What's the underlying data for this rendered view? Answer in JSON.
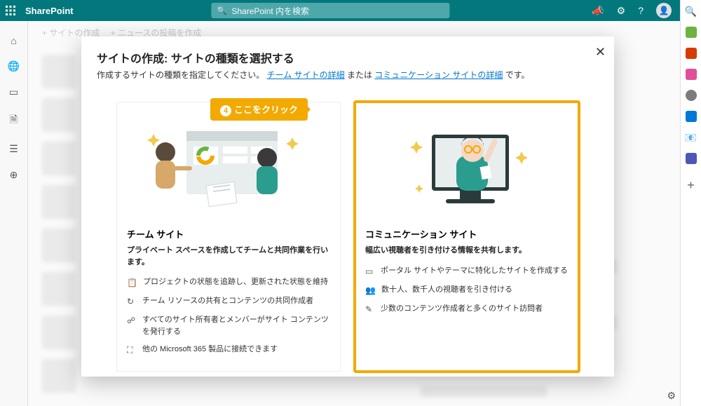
{
  "header": {
    "title": "SharePoint",
    "search_placeholder": "SharePoint 内を検索"
  },
  "toolbar": {
    "create_site": "+ サイトの作成",
    "create_news": "+ ニュースの投稿を作成"
  },
  "modal": {
    "title": "サイトの作成: サイトの種類を選択する",
    "subtitle_prefix": "作成するサイトの種類を指定してください。",
    "link_team": "チーム サイトの詳細",
    "subtitle_or": " または ",
    "link_comm": "コミュニケーション サイトの詳細",
    "subtitle_suffix": " です。"
  },
  "callout": {
    "num": "4",
    "text": "ここをクリック"
  },
  "cards": {
    "team": {
      "title": "チーム サイト",
      "desc": "プライベート スペースを作成してチームと共同作業を行います。",
      "items": [
        "プロジェクトの状態を追跡し、更新された状態を維持",
        "チーム リソースの共有とコンテンツの共同作成者",
        "すべてのサイト所有者とメンバーがサイト コンテンツを発行する",
        "他の Microsoft 365 製品に接続できます"
      ]
    },
    "comm": {
      "title": "コミュニケーション サイト",
      "desc": "幅広い視聴者を引き付ける情報を共有します。",
      "items": [
        "ポータル サイトやテーマに特化したサイトを作成する",
        "数十人、数千人の視聴者を引き付ける",
        "少数のコンテンツ作成者と多くのサイト訪問者"
      ]
    }
  }
}
